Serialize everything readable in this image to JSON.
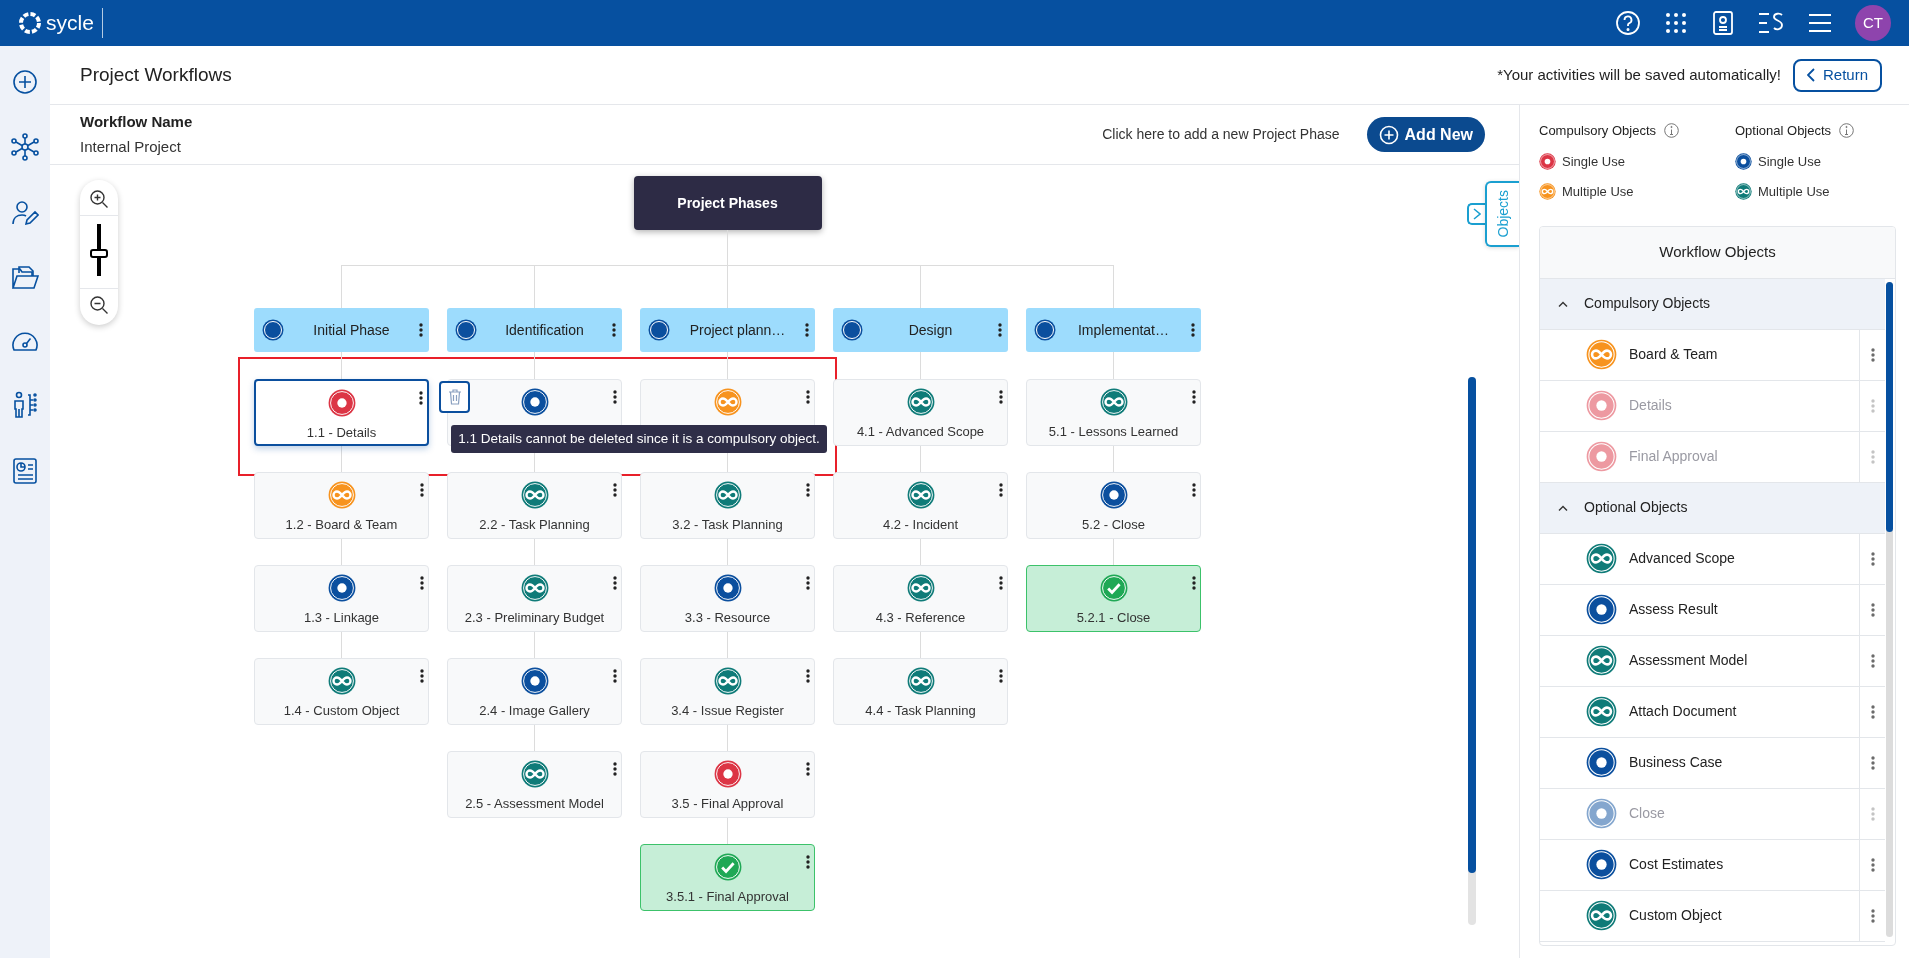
{
  "app": {
    "logo": "sycle",
    "avatar": "CT"
  },
  "page": {
    "title": "Project Workflows",
    "autosave_note": "*Your activities will be saved automatically!",
    "return_button": "Return"
  },
  "workflow": {
    "name_label": "Workflow Name",
    "name": "Internal Project",
    "add_hint": "Click here to add a new Project Phase",
    "add_button": "Add New"
  },
  "zoom": {
    "level": 0.42
  },
  "root": "Project Phases",
  "phases": [
    {
      "title": "Initial Phase",
      "nodes": [
        {
          "label": "1.1 - Details",
          "kind": "single",
          "compulsory": true,
          "selected": true
        },
        {
          "label": "1.2 - Board & Team",
          "kind": "multiple",
          "compulsory": true,
          "selected": false
        },
        {
          "label": "1.3 - Linkage",
          "kind": "single",
          "compulsory": false,
          "selected": false
        },
        {
          "label": "1.4 - Custom Object",
          "kind": "multiple",
          "compulsory": false,
          "selected": false
        }
      ]
    },
    {
      "title": "Identification",
      "nodes": [
        {
          "kind": "single",
          "compulsory": false,
          "selected": false
        },
        {
          "label": "2.2 - Task Planning",
          "kind": "multiple",
          "compulsory": false,
          "selected": false
        },
        {
          "label": "2.3 - Preliminary Budget",
          "kind": "multiple",
          "compulsory": false,
          "selected": false
        },
        {
          "label": "2.4 - Image Gallery",
          "kind": "single",
          "compulsory": false,
          "selected": false
        },
        {
          "label": "2.5 - Assessment Model",
          "kind": "multiple",
          "compulsory": false,
          "selected": false
        }
      ]
    },
    {
      "title": "Project plann…",
      "nodes": [
        {
          "kind": "multiple",
          "compulsory": true,
          "selected": false
        },
        {
          "label": "3.2 - Task Planning",
          "kind": "multiple",
          "compulsory": false,
          "selected": false
        },
        {
          "label": "3.3 - Resource",
          "kind": "single",
          "compulsory": false,
          "selected": false
        },
        {
          "label": "3.4 - Issue Register",
          "kind": "multiple",
          "compulsory": false,
          "selected": false
        },
        {
          "label": "3.5 - Final Approval",
          "kind": "single",
          "compulsory": true,
          "selected": false
        },
        {
          "label": "3.5.1 - Final Approval",
          "kind": "completed",
          "selected": false
        }
      ]
    },
    {
      "title": "Design",
      "nodes": [
        {
          "label": "4.1 - Advanced Scope",
          "kind": "multiple",
          "compulsory": false,
          "selected": false
        },
        {
          "label": "4.2 - Incident",
          "kind": "multiple",
          "compulsory": false,
          "selected": false
        },
        {
          "label": "4.3 - Reference",
          "kind": "multiple",
          "compulsory": false,
          "selected": false
        },
        {
          "label": "4.4 - Task Planning",
          "kind": "multiple",
          "compulsory": false,
          "selected": false
        }
      ]
    },
    {
      "title": "Implementat…",
      "nodes": [
        {
          "label": "5.1 - Lessons Learned",
          "kind": "multiple",
          "compulsory": false,
          "selected": false
        },
        {
          "label": "5.2 - Close",
          "kind": "single",
          "compulsory": false,
          "selected": false
        },
        {
          "label": "5.2.1 - Close",
          "kind": "completed",
          "selected": false
        }
      ]
    }
  ],
  "tooltip": "1.1 Details cannot be deleted since it is a compulsory object.",
  "objects_tab": "Objects",
  "legend": [
    {
      "title": "Compulsory Objects",
      "compulsory": true,
      "items": [
        {
          "label": "Single Use",
          "kind": "single"
        },
        {
          "label": "Multiple Use",
          "kind": "multiple"
        }
      ]
    },
    {
      "title": "Optional Objects",
      "compulsory": false,
      "items": [
        {
          "label": "Single Use",
          "kind": "single"
        },
        {
          "label": "Multiple Use",
          "kind": "multiple"
        }
      ]
    }
  ],
  "panel": {
    "title": "Workflow Objects",
    "groups": [
      {
        "title": "Compulsory Objects",
        "compulsory": true,
        "expanded": true,
        "items": [
          {
            "label": "Board & Team",
            "kind": "multiple",
            "disabled": false
          },
          {
            "label": "Details",
            "kind": "single",
            "disabled": true
          },
          {
            "label": "Final Approval",
            "kind": "single",
            "disabled": true
          }
        ]
      },
      {
        "title": "Optional Objects",
        "compulsory": false,
        "expanded": true,
        "items": [
          {
            "label": "Advanced Scope",
            "kind": "multiple",
            "disabled": false
          },
          {
            "label": "Assess Result",
            "kind": "single",
            "disabled": false
          },
          {
            "label": "Assessment Model",
            "kind": "multiple",
            "disabled": false
          },
          {
            "label": "Attach Document",
            "kind": "multiple",
            "disabled": false
          },
          {
            "label": "Business Case",
            "kind": "single",
            "disabled": false
          },
          {
            "label": "Close",
            "kind": "single",
            "disabled": true
          },
          {
            "label": "Cost Estimates",
            "kind": "single",
            "disabled": false
          },
          {
            "label": "Custom Object",
            "kind": "multiple",
            "disabled": false
          }
        ]
      }
    ]
  }
}
